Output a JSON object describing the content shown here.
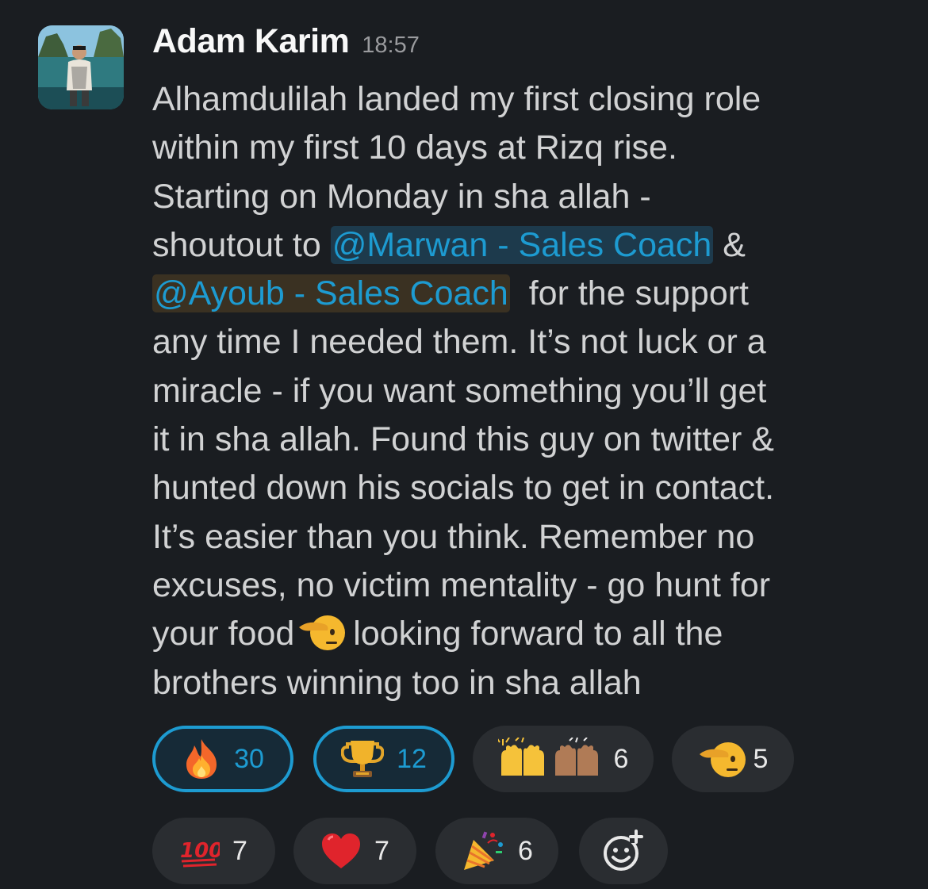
{
  "message": {
    "author": "Adam Karim",
    "timestamp": "18:57",
    "lines": {
      "l1": "Alhamdulilah landed my first closing role",
      "l2": "within my first 10 days at Rizq rise.",
      "l3": "Starting on Monday in sha allah -",
      "l4a": "shoutout to ",
      "l4b": " & ",
      "l5b": "  for the support",
      "l6": "any time I needed them. It’s not luck or a",
      "l7": "miracle - if you want something you’ll get",
      "l8": "it in sha allah. Found this guy on twitter &",
      "l9": "hunted down his socials to get in contact.",
      "l10": "It’s easier than you think. Remember no",
      "l11": "excuses, no victim mentality - go hunt for",
      "l12a": "your food",
      "l12b": "looking forward to all the",
      "l13": "brothers winning too in sha allah"
    },
    "mentions": {
      "marwan": "@Marwan - Sales Coach",
      "ayoub": "@Ayoub - Sales Coach"
    },
    "inline_emoji": "saluting-face"
  },
  "reactions": [
    {
      "emoji": "fire",
      "count": "30",
      "active": true
    },
    {
      "emoji": "trophy",
      "count": "12",
      "active": true
    },
    {
      "emoji": "raised-hands",
      "count": "6",
      "active": false
    },
    {
      "emoji": "saluting-face",
      "count": "5",
      "active": false
    },
    {
      "emoji": "hundred-points",
      "count": "7",
      "active": false
    },
    {
      "emoji": "red-heart",
      "count": "7",
      "active": false
    },
    {
      "emoji": "party-popper",
      "count": "6",
      "active": false
    },
    {
      "emoji": "add-reaction",
      "count": "",
      "active": false
    }
  ],
  "colors": {
    "background": "#1a1d21",
    "mention_text": "#1d9bd1",
    "active_reaction_border": "#1d9bd1"
  }
}
